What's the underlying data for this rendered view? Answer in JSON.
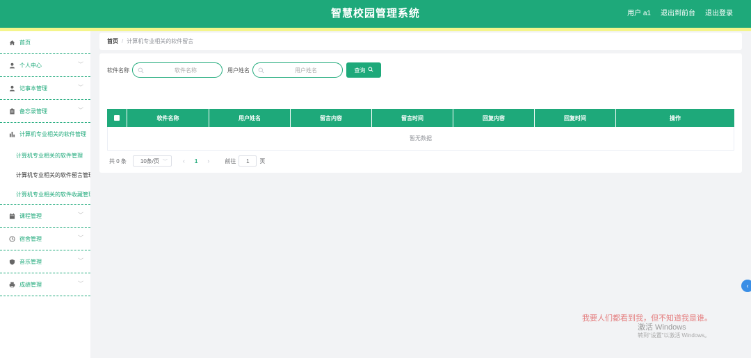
{
  "header": {
    "title": "智慧校园管理系统",
    "user": "用户 a1",
    "back_front": "退出到前台",
    "logout": "退出登录"
  },
  "sidebar": {
    "items": [
      {
        "label": "首页",
        "icon": "home-icon",
        "expandable": false
      },
      {
        "label": "个人中心",
        "icon": "user-icon",
        "expandable": true
      },
      {
        "label": "记事本管理",
        "icon": "user-icon",
        "expandable": true
      },
      {
        "label": "备忘录管理",
        "icon": "clipboard-icon",
        "expandable": true
      },
      {
        "label": "计算机专业相关的软件管理",
        "icon": "bar-chart-icon",
        "expandable": false
      },
      {
        "label": "课程管理",
        "icon": "calendar-icon",
        "expandable": true
      },
      {
        "label": "宿舍管理",
        "icon": "clock-icon",
        "expandable": true
      },
      {
        "label": "音乐管理",
        "icon": "shield-icon",
        "expandable": true
      },
      {
        "label": "成绩管理",
        "icon": "printer-icon",
        "expandable": true
      }
    ],
    "subitems": [
      {
        "label": "计算机专业相关的软件管理",
        "active": false
      },
      {
        "label": "计算机专业相关的软件留言管理",
        "active": true
      },
      {
        "label": "计算机专业相关的软件收藏管理",
        "active": false
      }
    ]
  },
  "breadcrumb": {
    "home": "首页",
    "separator": "/",
    "current": "计算机专业相关的软件留言"
  },
  "search": {
    "field1_label": "软件名称",
    "field1_placeholder": "软件名称",
    "field2_label": "用户姓名",
    "field2_placeholder": "用户姓名",
    "button_label": "查询"
  },
  "table": {
    "columns": [
      "软件名称",
      "用户姓名",
      "留言内容",
      "留言时间",
      "回复内容",
      "回复时间",
      "操作"
    ],
    "empty_text": "暂无数据"
  },
  "pagination": {
    "total": "共 0 条",
    "page_size": "10条/页",
    "current_page": "1",
    "goto_label": "前往",
    "goto_value": "1",
    "page_unit": "页"
  },
  "watermark": {
    "line1": "我要人们都看到我，但不知道我是谁。",
    "line2": "激活 Windows",
    "line3": "转到“设置”以激活 Windows。"
  },
  "colors": {
    "primary": "#1ea97a",
    "accent_bar": "#f4f58b",
    "background": "#f2f3f5",
    "toggle": "#3a8ee6"
  }
}
